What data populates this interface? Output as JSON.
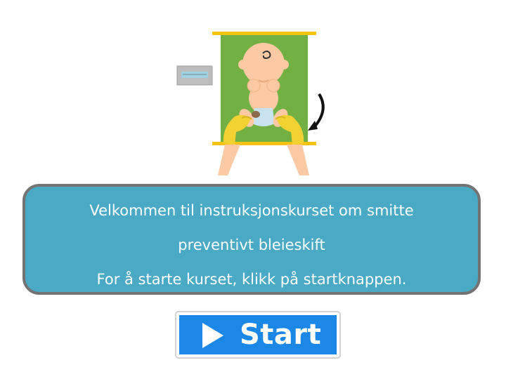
{
  "welcome": {
    "line1": "Velkommen til instruksjonskurset om smitte",
    "line2": "preventivt bleieskift",
    "line3": "For å starte kurset, klikk på startknappen."
  },
  "start_button": {
    "label": "Start",
    "icon": "play-icon"
  },
  "colors": {
    "panel": "#4aa9c4",
    "panel_border": "#737373",
    "button": "#1b87e6",
    "changing_mat": "#72b043",
    "mat_bar": "#f5c312",
    "glove": "#f2d233",
    "skin": "#fbc9a3"
  }
}
